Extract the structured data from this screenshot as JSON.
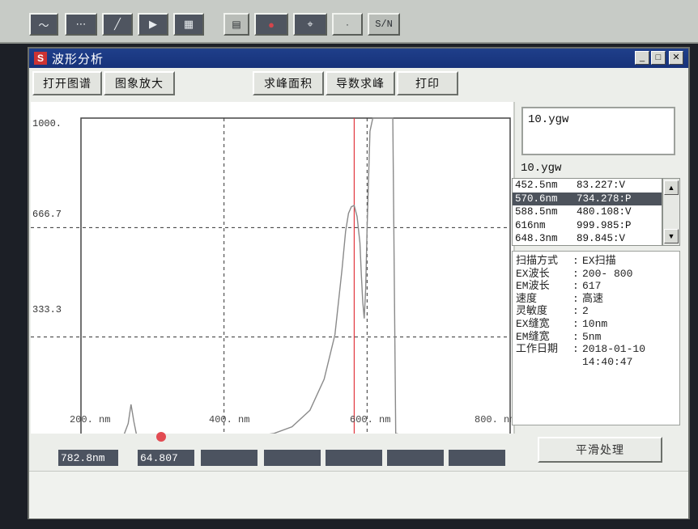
{
  "toolbar": {
    "buttons": [
      {
        "name": "waveform-tool-button",
        "icon": "waveform-icon",
        "glyph": "〜"
      },
      {
        "name": "scan-tool-button",
        "icon": "scan-icon",
        "glyph": "⋯"
      },
      {
        "name": "edit-tool-button",
        "icon": "pencil-icon",
        "glyph": "╱"
      },
      {
        "name": "flag-tool-button",
        "icon": "flag-icon",
        "glyph": "▶"
      },
      {
        "name": "grid-tool-button",
        "icon": "grid-icon",
        "glyph": "▦"
      },
      {
        "name": "doc-tool-button",
        "icon": "document-icon",
        "glyph": "▤"
      },
      {
        "name": "record-tool-button",
        "icon": "record-icon",
        "glyph": "●"
      },
      {
        "name": "xy-tool-button",
        "icon": "axes-icon",
        "glyph": "⌖"
      },
      {
        "name": "disabled-tool-button",
        "icon": "blank-icon",
        "glyph": "·"
      }
    ],
    "sn_label": "S/N"
  },
  "window": {
    "icon_letter": "S",
    "title": "波形分析",
    "controls": {
      "minimize": "_",
      "maximize": "□",
      "close": "✕"
    }
  },
  "dialog_buttons": {
    "open": "打开图谱",
    "zoom": "图象放大",
    "area": "求峰面积",
    "derivative": "导数求峰",
    "print": "打印"
  },
  "chart_data": {
    "type": "line",
    "title": "",
    "xlabel": "",
    "ylabel": "",
    "xlim": [
      200,
      800
    ],
    "ylim": [
      0,
      1000
    ],
    "y_tick_labels": [
      "1000.",
      "666.7",
      "333.3"
    ],
    "x_tick_labels": [
      "200. nm",
      "400. nm",
      "600. nm",
      "800. nm"
    ],
    "grid": "dashed at 400nm, 600nm, 333.3, 666.7",
    "cursor_x": 582,
    "series": [
      {
        "color": "#8a8a8a",
        "x": [
          200,
          220,
          240,
          260,
          266,
          270,
          274,
          278,
          284,
          300,
          330,
          360,
          400,
          440,
          470,
          495,
          520,
          540,
          555,
          565,
          570,
          574,
          578,
          582,
          586,
          590,
          592,
          594,
          596,
          598,
          600,
          604,
          608,
          612,
          616,
          620,
          624,
          628,
          632,
          636,
          640,
          650,
          660,
          700,
          760,
          800
        ],
        "y": [
          22,
          25,
          28,
          35,
          70,
          128,
          75,
          32,
          27,
          26,
          24,
          24,
          26,
          30,
          40,
          60,
          110,
          205,
          340,
          540,
          655,
          710,
          730,
          734,
          700,
          620,
          520,
          440,
          390,
          480,
          660,
          960,
          1000,
          1000,
          1000,
          1000,
          1000,
          1000,
          1000,
          1000,
          40,
          34,
          28,
          24,
          22,
          22
        ]
      }
    ]
  },
  "file_box": {
    "name": "10.ygw"
  },
  "peak_group_label": "10.ygw",
  "peaks": [
    {
      "wl": "452.5nm",
      "val": "83.227:V"
    },
    {
      "wl": "570.6nm",
      "val": "734.278:P"
    },
    {
      "wl": "588.5nm",
      "val": "480.108:V"
    },
    {
      "wl": "616nm",
      "val": "999.985:P"
    },
    {
      "wl": "648.3nm",
      "val": "89.845:V"
    }
  ],
  "selected_peak_index": 1,
  "scan_info": [
    {
      "label": "扫描方式",
      "sep": ":",
      "value": "EX扫描"
    },
    {
      "label": "EX波长",
      "sep": ":",
      "value": "200- 800"
    },
    {
      "label": "EM波长",
      "sep": ":",
      "value": "617"
    },
    {
      "label": "速度",
      "sep": ":",
      "value": "高速"
    },
    {
      "label": "灵敏度",
      "sep": ":",
      "value": "2"
    },
    {
      "label": "EX缝宽",
      "sep": ":",
      "value": "10nm"
    },
    {
      "label": "EM缝宽",
      "sep": ":",
      "value": "5nm"
    },
    {
      "label": "工作日期",
      "sep": ":",
      "value": "2018-01-10"
    },
    {
      "label": "",
      "sep": "",
      "value": "14:40:47"
    }
  ],
  "readouts": {
    "wavelength": "782.8nm",
    "intensity": "64.807",
    "blank1": "",
    "blank2": "",
    "blank3": "",
    "blank4": "",
    "blank5": ""
  },
  "smooth_button": "平滑处理",
  "colors": {
    "titlebar": "#1f3f8a",
    "curve": "#8a8a8a",
    "cursor_line": "#e2373f",
    "selection": "#4d535c",
    "readout_bg": "#4c5360"
  }
}
